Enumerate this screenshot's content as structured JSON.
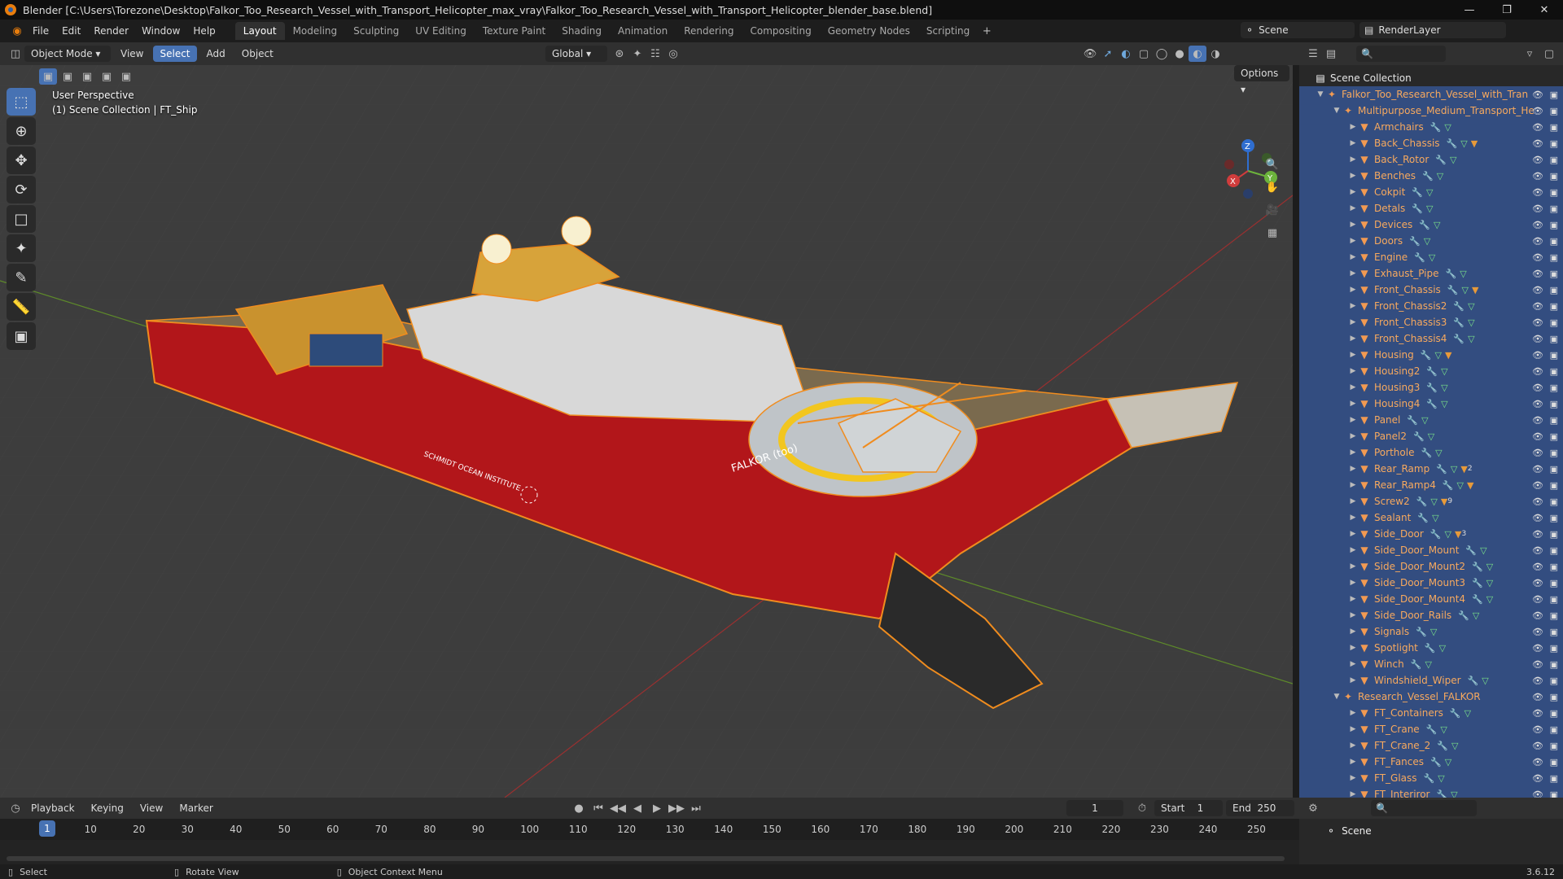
{
  "window": {
    "title": "Blender [C:\\Users\\Torezone\\Desktop\\Falkor_Too_Research_Vessel_with_Transport_Helicopter_max_vray\\Falkor_Too_Research_Vessel_with_Transport_Helicopter_blender_base.blend]"
  },
  "menu": [
    "File",
    "Edit",
    "Render",
    "Window",
    "Help"
  ],
  "workspaces": [
    "Layout",
    "Modeling",
    "Sculpting",
    "UV Editing",
    "Texture Paint",
    "Shading",
    "Animation",
    "Rendering",
    "Compositing",
    "Geometry Nodes",
    "Scripting"
  ],
  "scene_name": "Scene",
  "view_layer": "RenderLayer",
  "viewport": {
    "mode": "Object Mode",
    "menus": [
      "View",
      "Select",
      "Add",
      "Object"
    ],
    "transform_orientation": "Global",
    "options_label": "Options",
    "overlay_line1": "User Perspective",
    "overlay_line2": "(1) Scene Collection | FT_Ship",
    "ship_name": "FALKOR (too)",
    "institute": "SCHMIDT OCEAN INSTITUTE",
    "axis_x": "X",
    "axis_y": "Y",
    "axis_z": "Z"
  },
  "outliner": {
    "root": "Scene Collection",
    "collection1": "Falkor_Too_Research_Vessel_with_Tran",
    "collection2": "Multipurpose_Medium_Transport_He",
    "items": [
      {
        "name": "Armchairs",
        "extra": ""
      },
      {
        "name": "Back_Chassis",
        "extra": "mat"
      },
      {
        "name": "Back_Rotor",
        "extra": ""
      },
      {
        "name": "Benches",
        "extra": ""
      },
      {
        "name": "Cokpit",
        "extra": ""
      },
      {
        "name": "Detals",
        "extra": ""
      },
      {
        "name": "Devices",
        "extra": ""
      },
      {
        "name": "Doors",
        "extra": ""
      },
      {
        "name": "Engine",
        "extra": ""
      },
      {
        "name": "Exhaust_Pipe",
        "extra": ""
      },
      {
        "name": "Front_Chassis",
        "extra": "mat"
      },
      {
        "name": "Front_Chassis2",
        "extra": ""
      },
      {
        "name": "Front_Chassis3",
        "extra": ""
      },
      {
        "name": "Front_Chassis4",
        "extra": ""
      },
      {
        "name": "Housing",
        "extra": "mat"
      },
      {
        "name": "Housing2",
        "extra": ""
      },
      {
        "name": "Housing3",
        "extra": ""
      },
      {
        "name": "Housing4",
        "extra": ""
      },
      {
        "name": "Panel",
        "extra": ""
      },
      {
        "name": "Panel2",
        "extra": ""
      },
      {
        "name": "Porthole",
        "extra": ""
      },
      {
        "name": "Rear_Ramp",
        "extra": "2"
      },
      {
        "name": "Rear_Ramp4",
        "extra": "mat"
      },
      {
        "name": "Screw2",
        "extra": "9"
      },
      {
        "name": "Sealant",
        "extra": ""
      },
      {
        "name": "Side_Door",
        "extra": "3"
      },
      {
        "name": "Side_Door_Mount",
        "extra": ""
      },
      {
        "name": "Side_Door_Mount2",
        "extra": ""
      },
      {
        "name": "Side_Door_Mount3",
        "extra": ""
      },
      {
        "name": "Side_Door_Mount4",
        "extra": ""
      },
      {
        "name": "Side_Door_Rails",
        "extra": ""
      },
      {
        "name": "Signals",
        "extra": ""
      },
      {
        "name": "Spotlight",
        "extra": ""
      },
      {
        "name": "Winch",
        "extra": ""
      },
      {
        "name": "Windshield_Wiper",
        "extra": ""
      }
    ],
    "collection3": "Research_Vessel_FALKOR",
    "items2": [
      "FT_Containers",
      "FT_Crane",
      "FT_Crane_2",
      "FT_Fances",
      "FT_Glass",
      "FT_Interiror"
    ]
  },
  "timeline": {
    "menus": [
      "Playback",
      "Keying",
      "View",
      "Marker"
    ],
    "current_frame": "1",
    "start_label": "Start",
    "start": "1",
    "end_label": "End",
    "end": "250",
    "ticks": [
      "1",
      "10",
      "20",
      "30",
      "40",
      "50",
      "60",
      "70",
      "80",
      "90",
      "100",
      "110",
      "120",
      "130",
      "140",
      "150",
      "160",
      "170",
      "180",
      "190",
      "200",
      "210",
      "220",
      "230",
      "240",
      "250"
    ]
  },
  "properties": {
    "scene": "Scene"
  },
  "status": {
    "select": "Select",
    "rotate": "Rotate View",
    "context": "Object Context Menu",
    "version": "3.6.12"
  }
}
